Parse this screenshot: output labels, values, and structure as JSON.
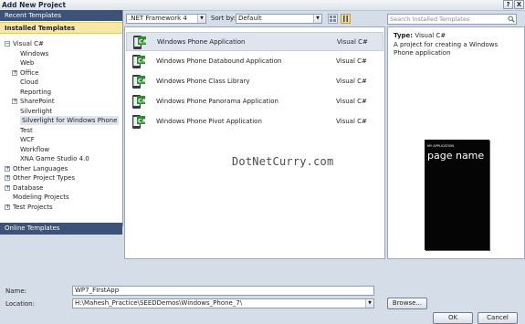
{
  "window": {
    "title": "Add New Project",
    "help_label": "?",
    "close_label": "X"
  },
  "sidebar": {
    "recent": "Recent Templates",
    "installed": "Installed Templates",
    "online": "Online Templates",
    "tree": [
      {
        "label": "Visual C#",
        "expander": "−"
      },
      {
        "label": "Windows"
      },
      {
        "label": "Web"
      },
      {
        "label": "Office",
        "expander": "+"
      },
      {
        "label": "Cloud"
      },
      {
        "label": "Reporting"
      },
      {
        "label": "SharePoint",
        "expander": "+"
      },
      {
        "label": "Silverlight"
      },
      {
        "label": "Silverlight for Windows Phone",
        "selected": true
      },
      {
        "label": "Test"
      },
      {
        "label": "WCF"
      },
      {
        "label": "Workflow"
      },
      {
        "label": "XNA Game Studio 4.0"
      },
      {
        "label": "Other Languages",
        "expander": "+"
      },
      {
        "label": "Other Project Types",
        "expander": "+"
      },
      {
        "label": "Database",
        "expander": "+"
      },
      {
        "label": "Modeling Projects"
      },
      {
        "label": "Test Projects",
        "expander": "+"
      }
    ]
  },
  "toolbar": {
    "framework": ".NET Framework 4",
    "sort_label": "Sort by:",
    "sort_value": "Default",
    "search_placeholder": "Search Installed Templates"
  },
  "templates": [
    {
      "name": "Windows Phone Application",
      "lang": "Visual C#",
      "selected": true
    },
    {
      "name": "Windows Phone Databound Application",
      "lang": "Visual C#"
    },
    {
      "name": "Windows Phone Class Library",
      "lang": "Visual C#"
    },
    {
      "name": "Windows Phone Panorama Application",
      "lang": "Visual C#"
    },
    {
      "name": "Windows Phone Pivot Application",
      "lang": "Visual C#"
    }
  ],
  "watermark": "DotNetCurry.com",
  "details": {
    "type_label": "Type:",
    "type_value": "Visual C#",
    "description": "A project for creating a Windows Phone application",
    "preview_small": "MY APPLICATION",
    "preview_title": "page name"
  },
  "form": {
    "name_label": "Name:",
    "name_value": "WP7_FIrstApp",
    "location_label": "Location:",
    "location_value": "H:\\Mahesh_Practice\\SEEDDemos\\Windows_Phone_7\\",
    "browse_label": "Browse...",
    "ok_label": "OK",
    "cancel_label": "Cancel"
  }
}
